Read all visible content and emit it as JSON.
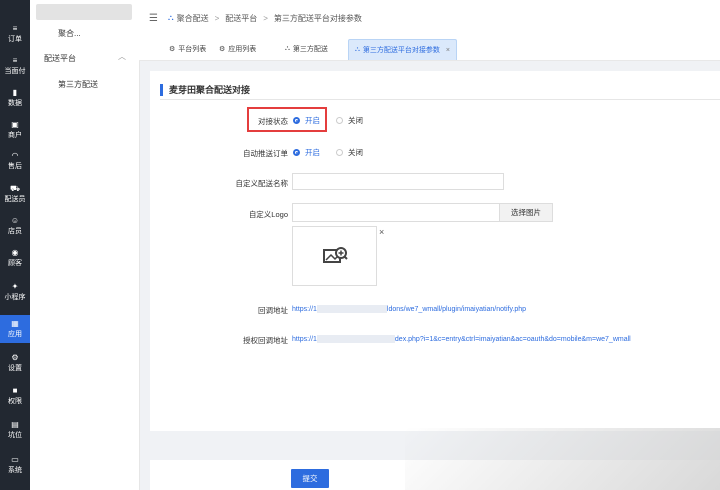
{
  "nav": [
    {
      "label": "订单",
      "icon": "≡",
      "name": "nav-orders"
    },
    {
      "label": "当面付",
      "icon": "≡",
      "name": "nav-face-pay"
    },
    {
      "label": "数据",
      "icon": "▮",
      "name": "nav-data"
    },
    {
      "label": "商户",
      "icon": "▣",
      "name": "nav-merchant"
    },
    {
      "label": "售后",
      "icon": "◠",
      "name": "nav-after-sales"
    },
    {
      "label": "配送员",
      "icon": "⛟",
      "name": "nav-courier"
    },
    {
      "label": "店员",
      "icon": "☺",
      "name": "nav-clerk"
    },
    {
      "label": "顾客",
      "icon": "◉",
      "name": "nav-customer"
    },
    {
      "label": "小程序",
      "icon": "✦",
      "name": "nav-miniapp"
    },
    {
      "label": "应用",
      "icon": "▦",
      "name": "nav-apps"
    },
    {
      "label": "设置",
      "icon": "⚙",
      "name": "nav-settings"
    },
    {
      "label": "权限",
      "icon": "■",
      "name": "nav-permissions"
    },
    {
      "label": "坑位",
      "icon": "▤",
      "name": "nav-slots"
    },
    {
      "label": "系统",
      "icon": "▭",
      "name": "nav-system"
    }
  ],
  "submenu": {
    "head": "聚合...",
    "group": "配送平台",
    "leaf": "第三方配送"
  },
  "breadcrumb": {
    "home": "聚合配送",
    "level2": "配送平台",
    "level3": "第三方配送平台对接参数",
    "sep": ">"
  },
  "tabs": [
    {
      "label": "平台列表"
    },
    {
      "label": "应用列表"
    },
    {
      "label": "第三方配送"
    },
    {
      "label": "第三方配送平台对接参数",
      "close": "×"
    }
  ],
  "form": {
    "section_title": "麦芽田聚合配送对接",
    "status_label": "对接状态",
    "status_on": "开启",
    "status_off": "关闭",
    "auto_label": "自动推送订单",
    "auto_on": "开启",
    "auto_off": "关闭",
    "name_label": "自定义配送名称",
    "logo_label": "自定义Logo",
    "pick_button": "选择图片",
    "thumb_close": "×",
    "callback_label": "回调地址",
    "callback_prefix": "https://1",
    "callback_suffix": "ldons/we7_wmall/plugin/imaiyatian/notify.php",
    "auth_label": "授权回调地址",
    "auth_prefix": "https://1",
    "auth_suffix": "dex.php?i=1&c=entry&ctrl=imaiyatian&ac=oauth&do=mobile&m=we7_wmall",
    "submit": "提交"
  },
  "colors": {
    "accent": "#2d6cdf",
    "sidebar": "#222831",
    "highlight": "#e43d3d"
  }
}
